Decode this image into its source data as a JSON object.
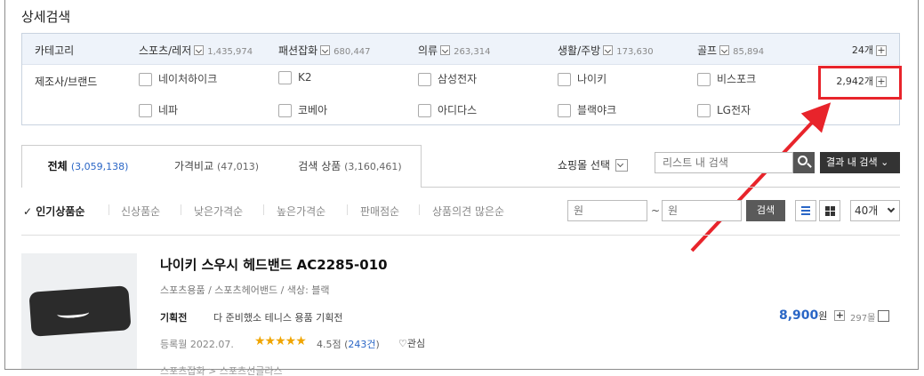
{
  "title": "상세검색",
  "filter": {
    "category_label": "카테고리",
    "categories": [
      {
        "name": "스포츠/레저",
        "count": "1,435,974"
      },
      {
        "name": "패션잡화",
        "count": "680,447"
      },
      {
        "name": "의류",
        "count": "263,314"
      },
      {
        "name": "생활/주방",
        "count": "173,630"
      },
      {
        "name": "골프",
        "count": "85,894"
      }
    ],
    "category_total": "24개",
    "brand_label": "제조사/브랜드",
    "brands": [
      "네이처하이크",
      "K2",
      "삼성전자",
      "나이키",
      "비스포크",
      "네파",
      "코베아",
      "아디다스",
      "블랙야크",
      "LG전자"
    ],
    "brand_total": "2,942개"
  },
  "tabs": [
    {
      "label": "전체",
      "count": "(3,059,138)"
    },
    {
      "label": "가격비교",
      "count": "(47,013)"
    },
    {
      "label": "검색 상품",
      "count": "(3,160,461)"
    }
  ],
  "toolbar": {
    "mall_select": "쇼핑몰 선택",
    "search_placeholder": "리스트 내 검색",
    "result_search": "결과 내 검색",
    "sort_options": [
      "인기상품순",
      "신상품순",
      "낮은가격순",
      "높은가격순",
      "판매점순",
      "상품의견 많은순"
    ],
    "check_mark": "✓",
    "price_min_placeholder": "원",
    "tilde": "~",
    "price_max_placeholder": "원",
    "price_go": "검색",
    "per_page": "40개"
  },
  "product": {
    "name": "나이키 스우시 헤드밴드 AC2285-010",
    "category": "스포츠용품 / 스포츠헤어밴드 / 색상: 블랙",
    "event_label": "기획전",
    "event_text": "다 준비했소 테니스 용품 기획전",
    "registered": "등록월 2022.07.",
    "stars": "★★★★★",
    "rating": "4.5점",
    "review_count": "243건",
    "favorite": "관심",
    "price": "8,900",
    "won": "원",
    "malls": "297몰",
    "next_category": "스포츠잡화 > 스포츠선글라스"
  },
  "colors": {
    "accent_blue": "#2a66c6",
    "highlight_red": "#e8242b",
    "star": "#f0a500"
  }
}
